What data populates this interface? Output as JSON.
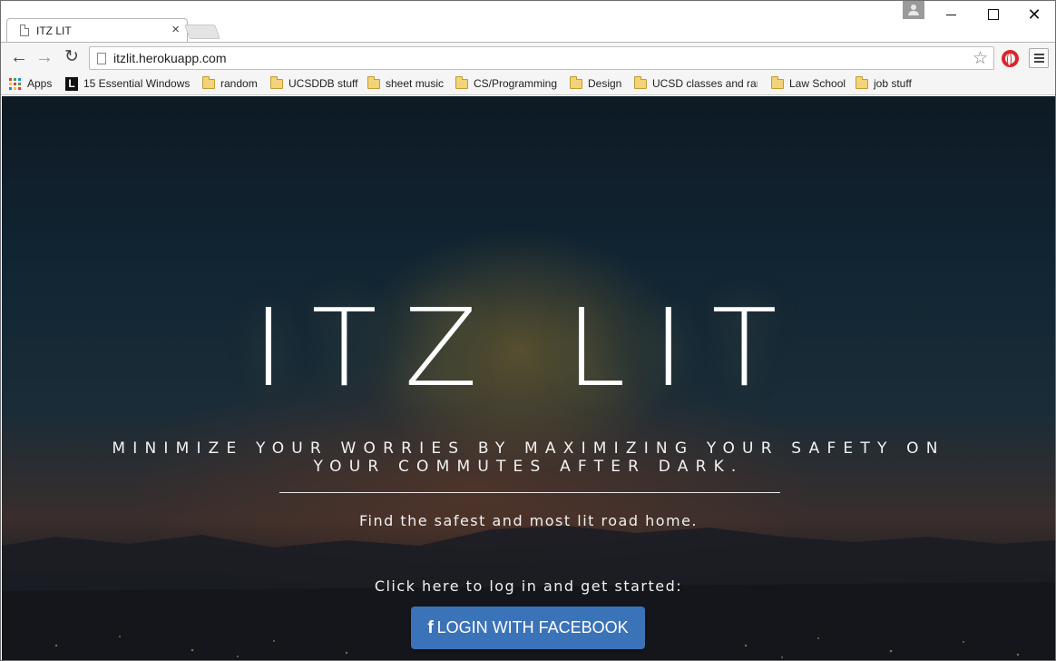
{
  "browser": {
    "tab_title": "ITZ LIT",
    "tab_close": "×",
    "url": "itzlit.herokuapp.com",
    "window_close": "✕"
  },
  "bookmarks": [
    {
      "label": "Apps",
      "icon": "apps-grid-icon"
    },
    {
      "label": "15 Essential Windows",
      "icon": "l-favicon-icon"
    },
    {
      "label": "random",
      "icon": "folder-icon"
    },
    {
      "label": "UCSDDB stuff",
      "icon": "folder-icon"
    },
    {
      "label": "sheet music",
      "icon": "folder-icon"
    },
    {
      "label": "CS/Programming",
      "icon": "folder-icon"
    },
    {
      "label": "Design",
      "icon": "folder-icon"
    },
    {
      "label": "UCSD classes and ran",
      "icon": "folder-icon"
    },
    {
      "label": "Law School",
      "icon": "folder-icon"
    },
    {
      "label": "job stuff",
      "icon": "folder-icon"
    }
  ],
  "hero": {
    "title": "ITZ LIT",
    "tagline": "MINIMIZE YOUR WORRIES BY MAXIMIZING YOUR SAFETY ON YOUR COMMUTES AFTER DARK.",
    "subline": "Find the safest and most lit road home.",
    "cta_text": "Click here to log in and get started:",
    "login_button": "LOGIN WITH FACEBOOK",
    "login_icon_glyph": "f",
    "button_color": "#3b73b9"
  }
}
